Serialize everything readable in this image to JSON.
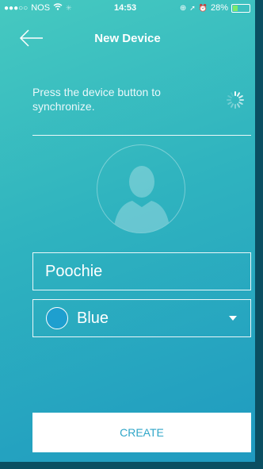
{
  "status_bar": {
    "signal": "●●●○○",
    "carrier": "NOS",
    "wifi_icon": "wifi-icon",
    "time": "14:53",
    "battery_percent": "28%",
    "battery_level": 0.28
  },
  "nav": {
    "title": "New Device",
    "back_icon": "arrow-left-icon"
  },
  "instruction": {
    "text": "Press the device button to synchronize.",
    "spinner_icon": "loading-spinner-icon"
  },
  "avatar": {
    "icon": "person-silhouette-icon"
  },
  "form": {
    "name_value": "Poochie",
    "color_label": "Blue",
    "color_value": "#1e9fcf"
  },
  "create_button": {
    "label": "CREATE"
  },
  "colors": {
    "gradient_top": "#46c9c0",
    "gradient_bottom": "#1f9ac0",
    "button_text": "#2fa6c8"
  }
}
